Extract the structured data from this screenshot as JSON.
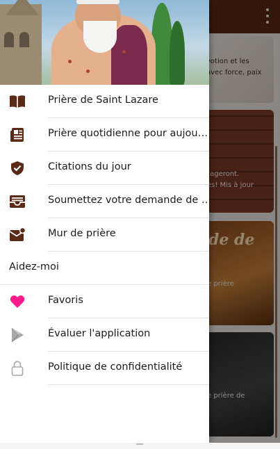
{
  "colors": {
    "accent": "#5a2a16",
    "icon_brown": "#5a2a16",
    "favorite_pink": "#ff1a8c",
    "muted_icon": "#9a9a9a"
  },
  "background": {
    "card1_text": [
      "votion et les",
      "avec force, paix"
    ],
    "card2_text": [
      "rageront.",
      "es! Mis à jour"
    ],
    "card3_heading": "de de",
    "card3_text": "e prière",
    "card4_text": "e prière de"
  },
  "drawer": {
    "items": [
      {
        "label": "Prière de Saint Lazare",
        "icon": "open-book-icon"
      },
      {
        "label": "Prière quotidienne pour aujou…",
        "icon": "newspaper-icon"
      },
      {
        "label": "Citations du jour",
        "icon": "shield-check-icon"
      },
      {
        "label": "Soumettez votre demande de …",
        "icon": "inbox-icon"
      },
      {
        "label": "Mur de prière",
        "icon": "mail-badge-icon"
      }
    ],
    "section_title": "Aidez-moi",
    "help_items": [
      {
        "label": "Favoris",
        "icon": "heart-icon"
      },
      {
        "label": "Évaluer l'application",
        "icon": "play-store-icon"
      },
      {
        "label": "Politique de confidentialité",
        "icon": "lock-icon"
      }
    ]
  }
}
